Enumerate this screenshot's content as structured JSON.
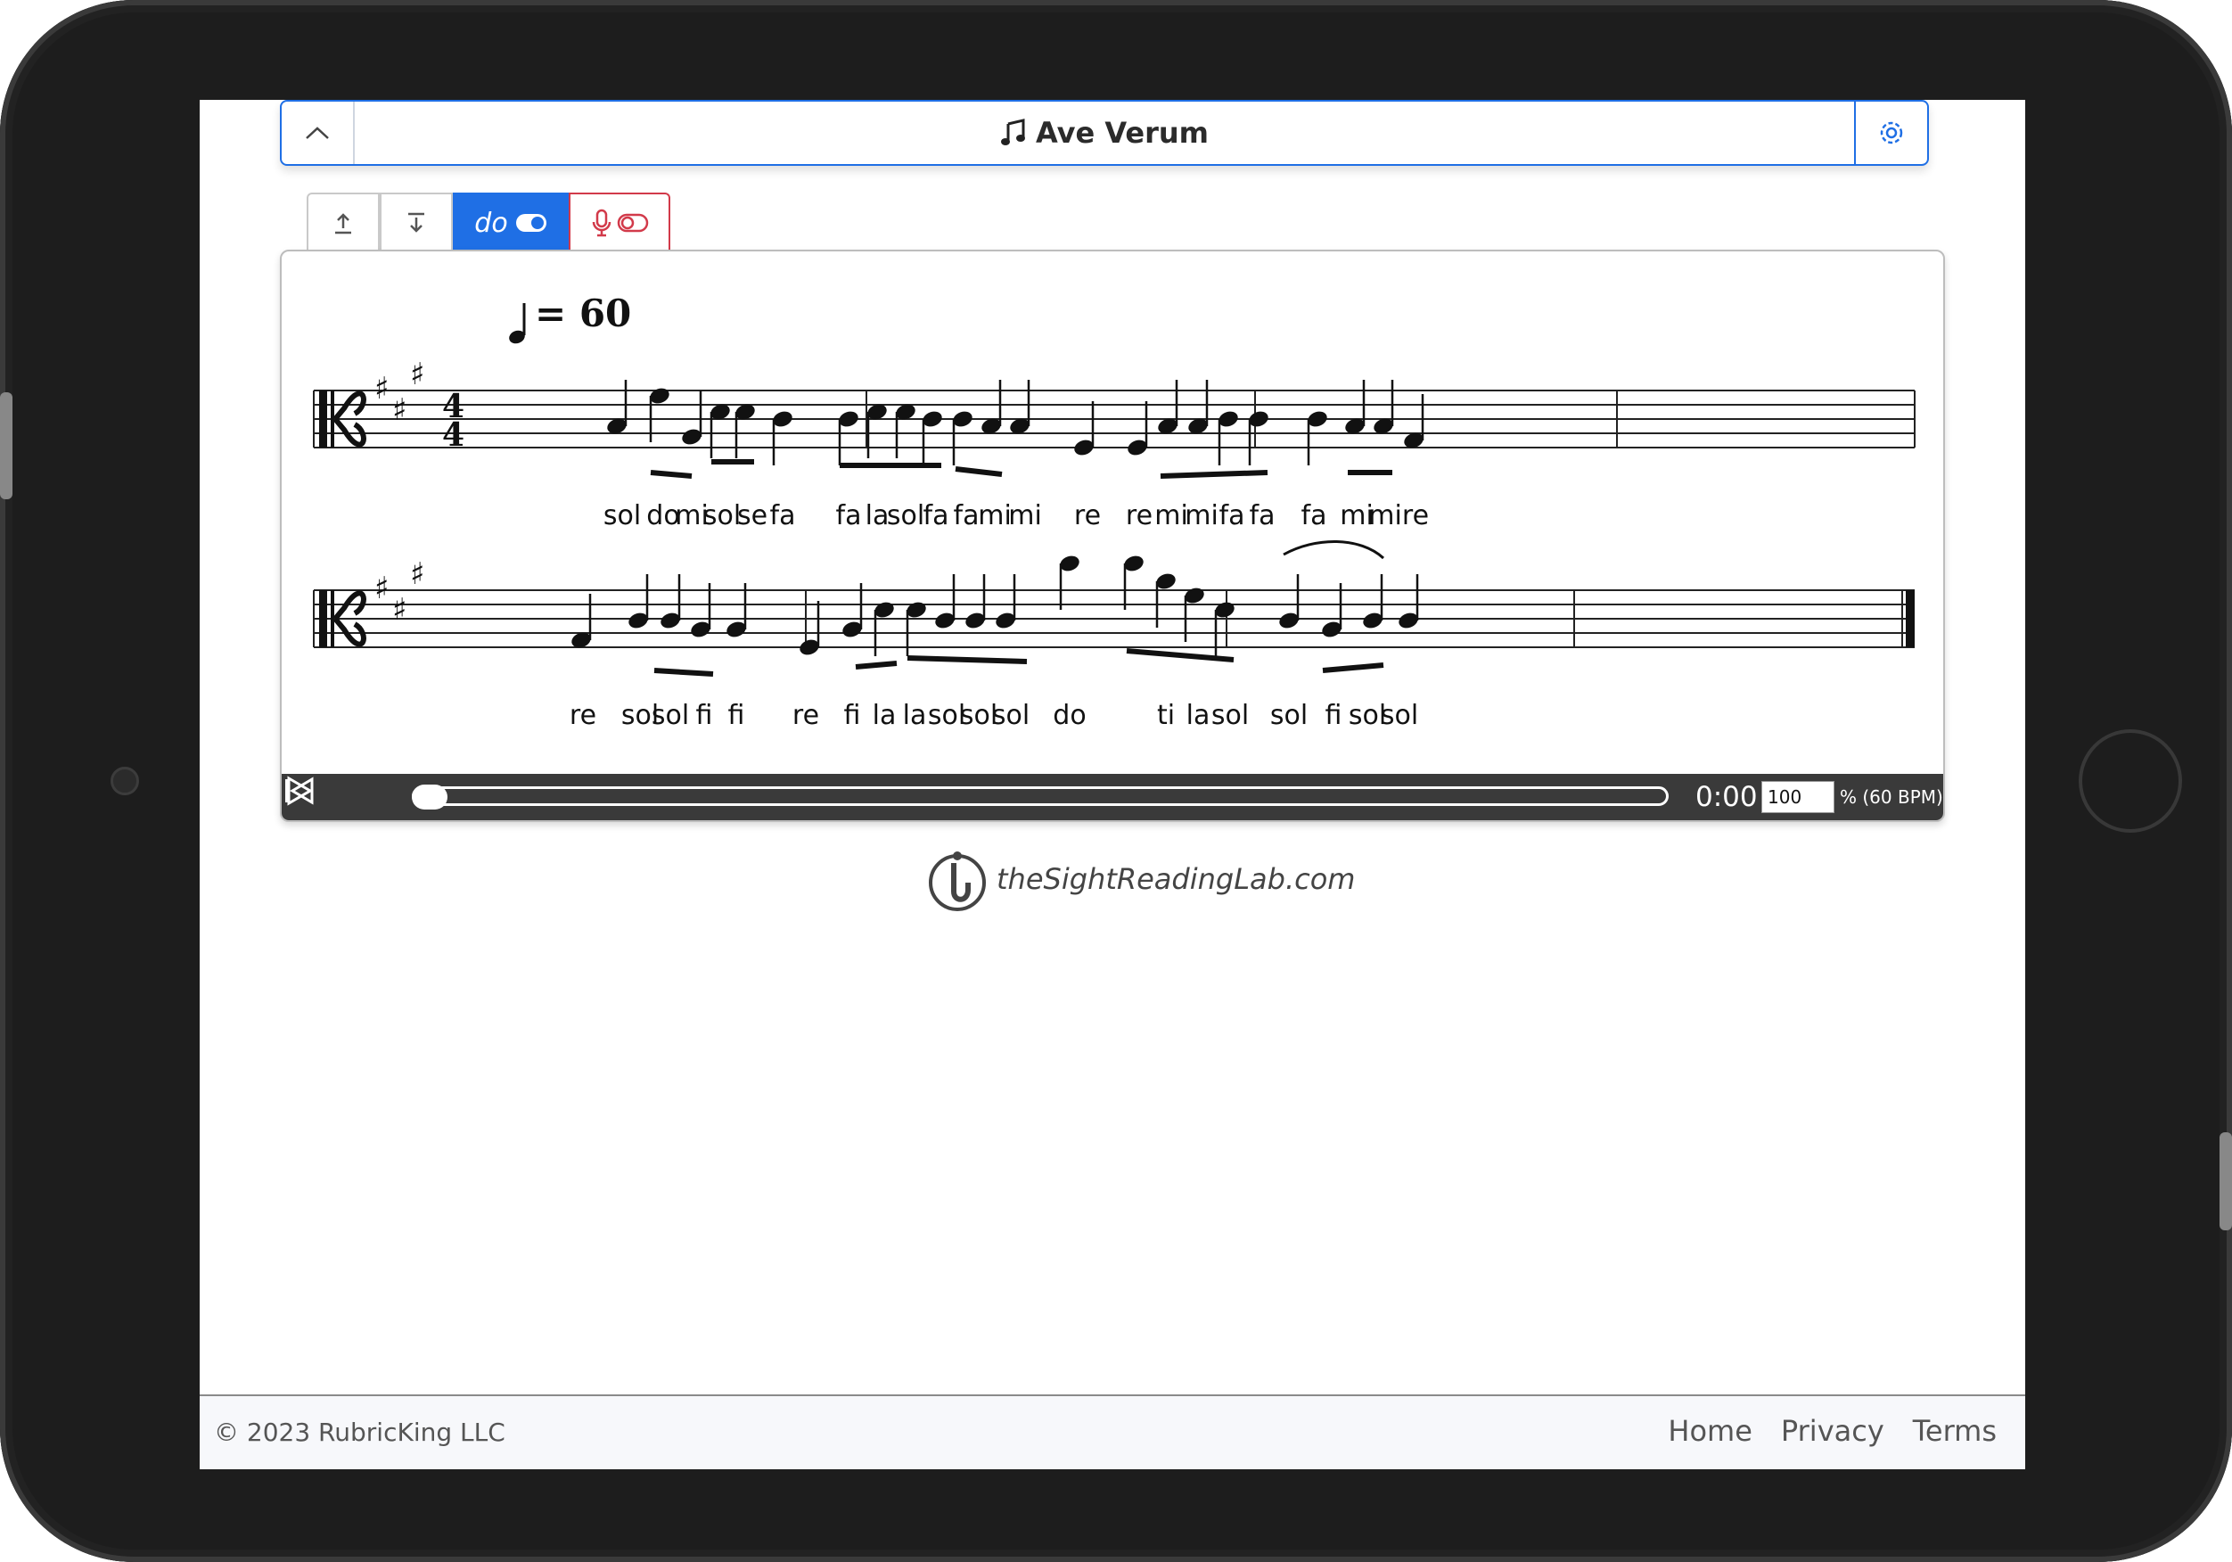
{
  "header": {
    "title": "Ave Verum",
    "collapse_icon": "chevron-up-icon",
    "settings_icon": "gear-icon"
  },
  "toolbar": {
    "upload_icon": "arrow-up-to-bar-icon",
    "download_icon": "arrow-down-to-bar-icon",
    "solfege_toggle_label": "do",
    "solfege_toggle_state": "on",
    "mic_toggle_state": "off"
  },
  "score": {
    "tempo_value": "= 60",
    "time_signature": [
      "4",
      "4"
    ],
    "line1_syllables": [
      "sol",
      "do",
      "mi",
      "sol",
      "se",
      "fa",
      "fa",
      "la",
      "sol",
      "fa",
      "fa",
      "mi",
      "mi",
      "re",
      "re",
      "mi",
      "mi",
      "fa",
      "fa",
      "fa",
      "mi",
      "mi",
      "re"
    ],
    "line2_syllables": [
      "re",
      "sol",
      "sol",
      "fi",
      "fi",
      "re",
      "fi",
      "la",
      "la",
      "sol",
      "sol",
      "sol",
      "do",
      "ti",
      "la",
      "sol",
      "sol",
      "fi",
      "sol",
      "sol"
    ]
  },
  "player": {
    "time": "0:00",
    "speed_value": "100",
    "bpm_label": "% (60 BPM)",
    "progress": 0
  },
  "logo": {
    "text": "theSightReadingLab.com"
  },
  "footer": {
    "copyright": "© 2023 RubricKing LLC",
    "links": [
      "Home",
      "Privacy",
      "Terms"
    ]
  },
  "colors": {
    "accent": "#1f6fe5",
    "mic": "#d23a4a",
    "player_bg": "#3a3a3a"
  }
}
